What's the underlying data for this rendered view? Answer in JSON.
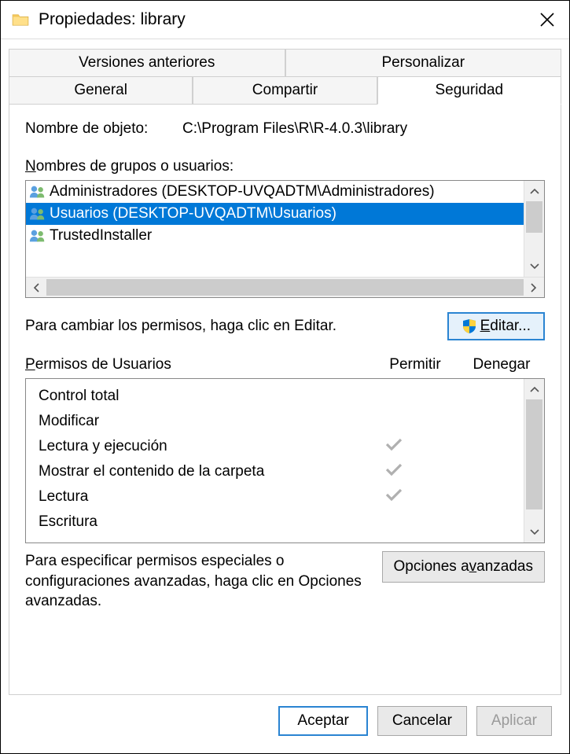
{
  "title": "Propiedades: library",
  "tabs": {
    "row1": [
      "Versiones anteriores",
      "Personalizar"
    ],
    "row2": [
      "General",
      "Compartir",
      "Seguridad"
    ]
  },
  "activeTab": "Seguridad",
  "objectLabel": "Nombre de objeto:",
  "objectPath": "C:\\Program Files\\R\\R-4.0.3\\library",
  "groupsLabel": "Nombres de grupos o usuarios:",
  "groups": [
    {
      "name": "Administradores (DESKTOP-UVQADTM\\Administradores)",
      "selected": false
    },
    {
      "name": "Usuarios (DESKTOP-UVQADTM\\Usuarios)",
      "selected": true
    },
    {
      "name": "TrustedInstaller",
      "selected": false
    }
  ],
  "editHint": "Para cambiar los permisos, haga clic en Editar.",
  "editButton": "Editar...",
  "permissionsTitle": "Permisos de Usuarios",
  "allowHeader": "Permitir",
  "denyHeader": "Denegar",
  "permissions": [
    {
      "name": "Control total",
      "allow": false,
      "deny": false
    },
    {
      "name": "Modificar",
      "allow": false,
      "deny": false
    },
    {
      "name": "Lectura y ejecución",
      "allow": true,
      "deny": false
    },
    {
      "name": "Mostrar el contenido de la carpeta",
      "allow": true,
      "deny": false
    },
    {
      "name": "Lectura",
      "allow": true,
      "deny": false
    },
    {
      "name": "Escritura",
      "allow": false,
      "deny": false
    }
  ],
  "advancedHint": "Para especificar permisos especiales o configuraciones avanzadas, haga clic en Opciones avanzadas.",
  "advancedButton": "Opciones avanzadas",
  "buttons": {
    "ok": "Aceptar",
    "cancel": "Cancelar",
    "apply": "Aplicar"
  }
}
